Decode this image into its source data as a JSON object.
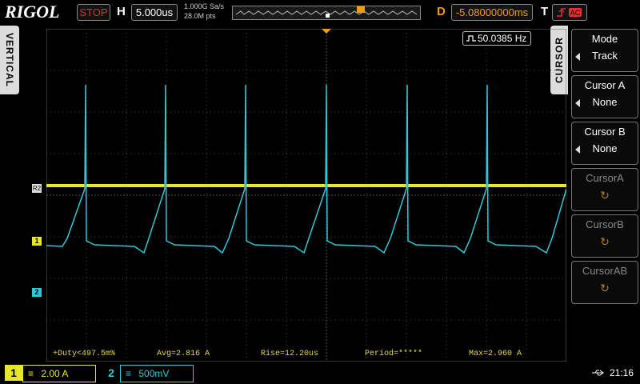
{
  "header": {
    "brand": "RIGOL",
    "run_state": "STOP",
    "horizontal_label": "H",
    "timebase": "5.000us",
    "sample_rate": "1.000G Sa/s",
    "memory_depth": "28.0M pts",
    "delay_label": "D",
    "delay": "-5.08000000ms",
    "trigger_label": "T"
  },
  "side_tabs": {
    "left": "VERTICAL",
    "right": "CURSOR"
  },
  "frequency_readout": "50.0385 Hz",
  "channel_markers": {
    "r2": "R2",
    "ch1": "1",
    "ch2": "2"
  },
  "cursor_menu": {
    "mode": {
      "title": "Mode",
      "value": "Track"
    },
    "cursor_a": {
      "title": "Cursor A",
      "value": "None"
    },
    "cursor_b": {
      "title": "Cursor B",
      "value": "None"
    },
    "cursor_a_knob": {
      "title": "CursorA"
    },
    "cursor_b_knob": {
      "title": "CursorB"
    },
    "cursor_ab_knob": {
      "title": "CursorAB"
    }
  },
  "measurements": {
    "duty": "+Duty<497.5m%",
    "avg": "Avg=2.816 A",
    "rise": "Rise=12.20us",
    "period": "Period=*****",
    "max": "Max=2.960 A"
  },
  "footer": {
    "ch1_number": "1",
    "ch1_scale": "2.00 A",
    "ch2_number": "2",
    "ch2_scale": "500mV",
    "clock": "21:16"
  },
  "colors": {
    "ch1": "#e6e62a",
    "ch2": "#30c8d8",
    "accent": "#f39c12"
  }
}
